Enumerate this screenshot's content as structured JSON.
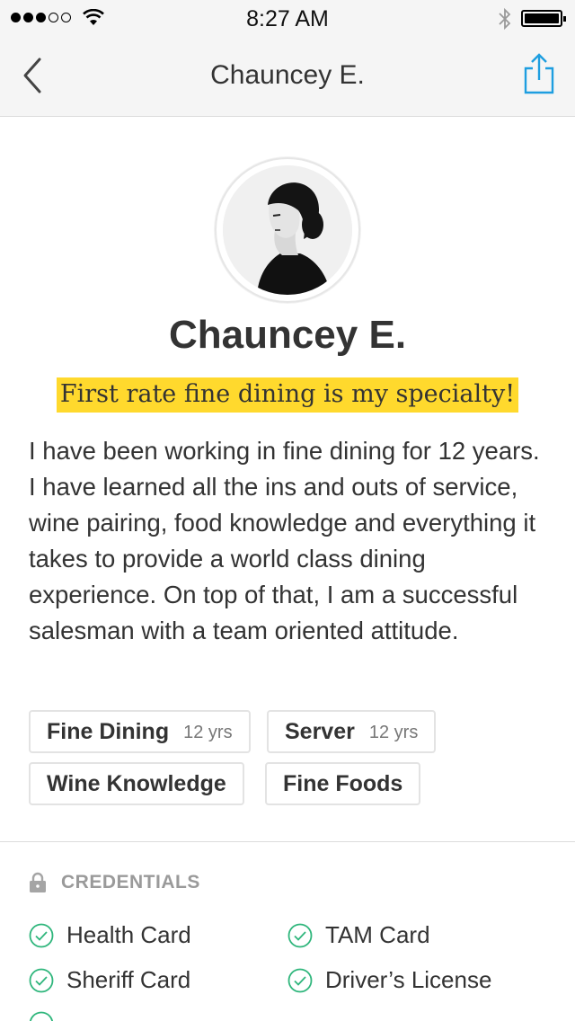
{
  "status_bar": {
    "time": "8:27 AM",
    "icons": [
      "signal-dots",
      "wifi-icon",
      "bluetooth-icon",
      "battery-icon"
    ]
  },
  "nav": {
    "title": "Chauncey E.",
    "back_icon": "chevron-left-icon",
    "share_icon": "share-icon"
  },
  "profile": {
    "name": "Chauncey E.",
    "tagline": "First rate fine dining is my specialty!",
    "bio": "I have been working in fine dining for 12 years. I have learned all the ins and outs of service, wine pairing, food knowledge and everything it takes to provide a world class dining experience. On top of that, I am a successful salesman with a team oriented attitude."
  },
  "skills": [
    {
      "name": "Fine Dining",
      "years": "12 yrs"
    },
    {
      "name": "Server",
      "years": "12 yrs"
    },
    {
      "name": "Wine Knowledge",
      "years": ""
    },
    {
      "name": "Fine Foods",
      "years": ""
    }
  ],
  "credentials": {
    "title": "CREDENTIALS",
    "items": [
      "Health Card",
      "TAM Card",
      "Sheriff Card",
      "Driver’s License"
    ]
  },
  "colors": {
    "highlight": "#ffd92d",
    "accent": "#2fb67c",
    "share": "#1e9ee0"
  }
}
